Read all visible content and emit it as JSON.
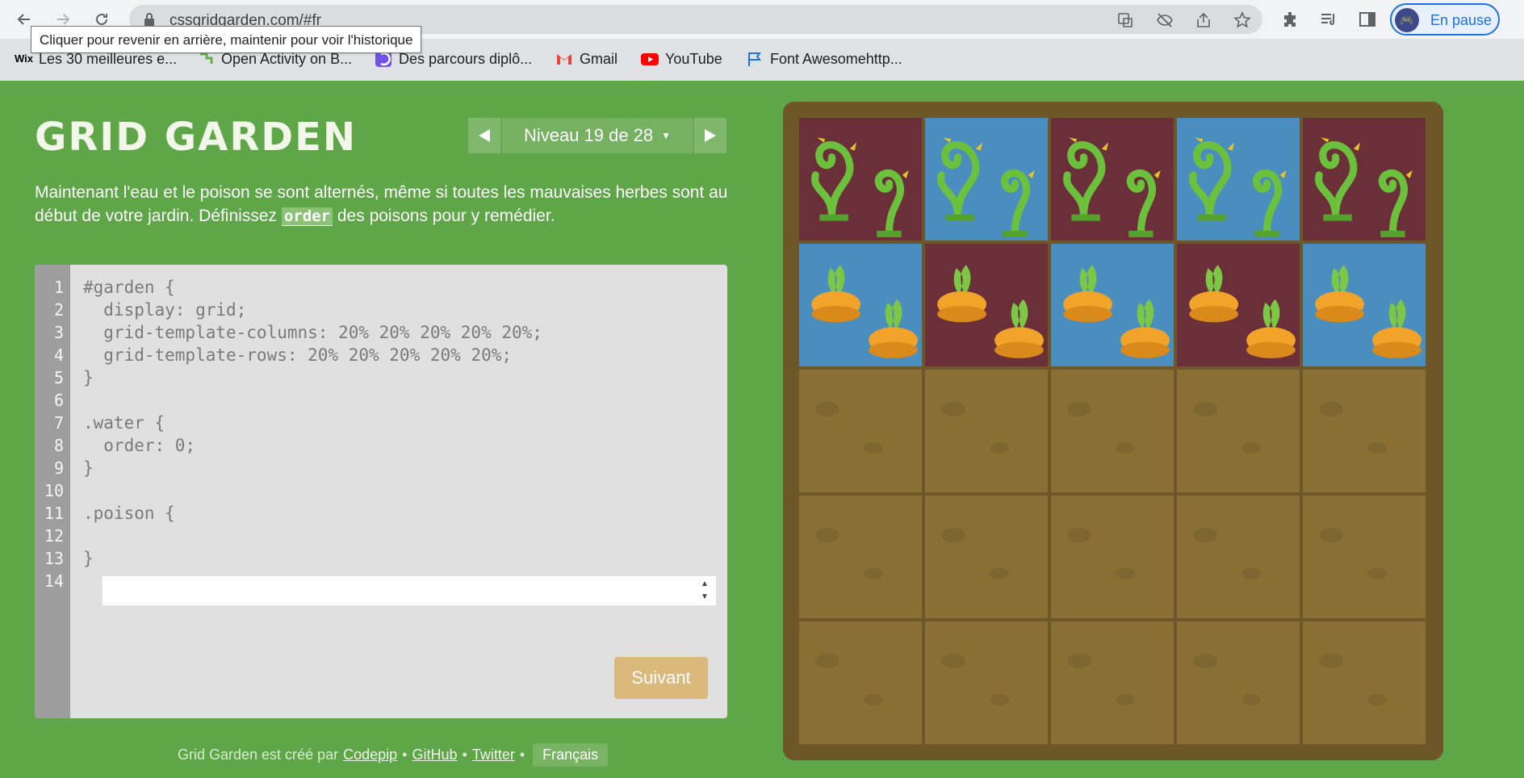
{
  "browser": {
    "url": "cssgridgarden.com/#fr",
    "tooltip": "Cliquer pour revenir en arrière, maintenir pour voir l'historique",
    "profile_label": "En pause",
    "bookmarks": [
      {
        "label": "Les 30 meilleures e...",
        "icon": "wix-icon"
      },
      {
        "label": "Open Activity on B...",
        "icon": "activity-icon"
      },
      {
        "label": "Des parcours diplô...",
        "icon": "openclassrooms-icon"
      },
      {
        "label": "Gmail",
        "icon": "gmail-icon"
      },
      {
        "label": "YouTube",
        "icon": "youtube-icon"
      },
      {
        "label": "Font Awesomehttp...",
        "icon": "flag-icon"
      }
    ]
  },
  "game": {
    "title": "GRID GARDEN",
    "level_label": "Niveau 19 de 28",
    "instructions_before": "Maintenant l'eau et le poison se sont alternés, même si toutes les mauvaises herbes sont au début de votre jardin. Définissez ",
    "instructions_code": "order",
    "instructions_after": " des poisons pour y remédier.",
    "code_lines": [
      "#garden {",
      "  display: grid;",
      "  grid-template-columns: 20% 20% 20% 20% 20%;",
      "  grid-template-rows: 20% 20% 20% 20% 20%;",
      "}",
      "",
      ".water {",
      "  order: 0;",
      "}",
      "",
      ".poison {",
      "",
      "}",
      ""
    ],
    "line_numbers": [
      "1",
      "2",
      "3",
      "4",
      "5",
      "6",
      "7",
      "8",
      "9",
      "10",
      "11",
      "12",
      "13",
      "14"
    ],
    "input_value": "",
    "next_label": "Suivant"
  },
  "footer": {
    "prefix": "Grid Garden est créé par",
    "link_codepip": "Codepip",
    "link_github": "GitHub",
    "link_twitter": "Twitter",
    "sep": "•",
    "language": "Français"
  },
  "garden": {
    "rows": [
      [
        "poison-weed",
        "water-weed",
        "poison-weed",
        "water-weed",
        "poison-weed"
      ],
      [
        "water-carrot",
        "poison-carrot",
        "water-carrot",
        "poison-carrot",
        "water-carrot"
      ],
      [
        "soil",
        "soil",
        "soil",
        "soil",
        "soil"
      ],
      [
        "soil",
        "soil",
        "soil",
        "soil",
        "soil"
      ],
      [
        "soil",
        "soil",
        "soil",
        "soil",
        "soil"
      ]
    ]
  },
  "colors": {
    "background": "#5ea648",
    "poison": "#6b2f3a",
    "water": "#4a8ebf",
    "soil": "#8a6f34",
    "frame": "#6d5628",
    "next_button": "#dbb87c"
  }
}
